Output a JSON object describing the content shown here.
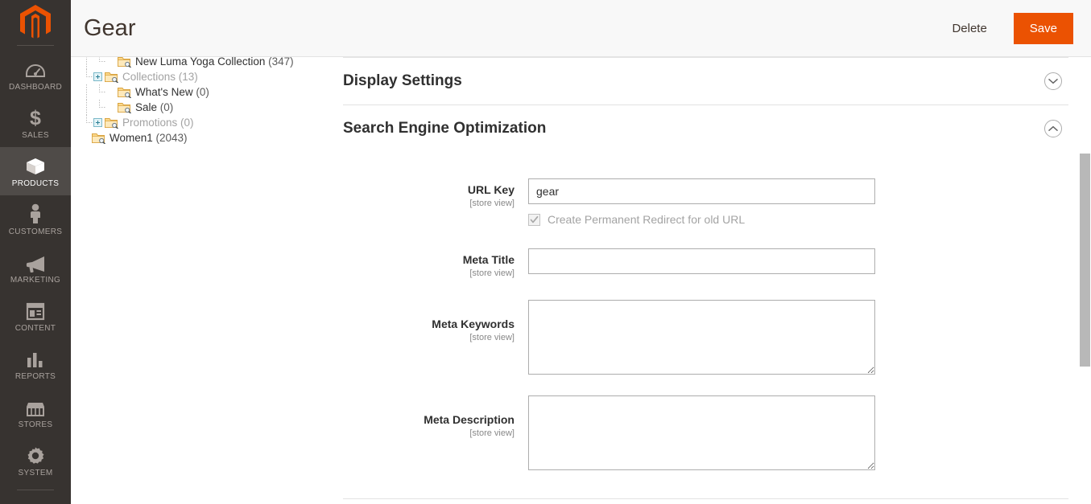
{
  "app": {
    "logo": "magento-logo",
    "brand_color": "#eb5202"
  },
  "sidebar": {
    "items": [
      {
        "label": "DASHBOARD",
        "icon": "dashboard-gauge-icon",
        "active": false
      },
      {
        "label": "SALES",
        "icon": "dollar-sign-icon",
        "active": false
      },
      {
        "label": "PRODUCTS",
        "icon": "box-icon",
        "active": true
      },
      {
        "label": "CUSTOMERS",
        "icon": "person-icon",
        "active": false
      },
      {
        "label": "MARKETING",
        "icon": "megaphone-icon",
        "active": false
      },
      {
        "label": "CONTENT",
        "icon": "layout-page-icon",
        "active": false
      },
      {
        "label": "REPORTS",
        "icon": "bar-chart-icon",
        "active": false
      },
      {
        "label": "STORES",
        "icon": "storefront-icon",
        "active": false
      },
      {
        "label": "SYSTEM",
        "icon": "gear-icon",
        "active": false
      }
    ]
  },
  "header": {
    "title": "Gear",
    "delete_label": "Delete",
    "save_label": "Save"
  },
  "category_tree": {
    "nodes": [
      {
        "label": "New Luma Yoga Collection",
        "count": "(347)",
        "indent": 2,
        "expandable": false,
        "muted": false,
        "last": false
      },
      {
        "label": "Collections",
        "count": "(13)",
        "indent": 1,
        "expandable": true,
        "muted": true,
        "last": false
      },
      {
        "label": "What's New",
        "count": "(0)",
        "indent": 2,
        "expandable": false,
        "muted": false,
        "last": false
      },
      {
        "label": "Sale",
        "count": "(0)",
        "indent": 2,
        "expandable": false,
        "muted": false,
        "last": true
      },
      {
        "label": "Promotions",
        "count": "(0)",
        "indent": 1,
        "expandable": true,
        "muted": true,
        "last": false
      },
      {
        "label": "Women1",
        "count": "(2043)",
        "indent": 0,
        "expandable": false,
        "muted": false,
        "last": true
      }
    ]
  },
  "main": {
    "sections": [
      {
        "title": "Display Settings",
        "expanded": false,
        "toggle_icon": "chevron-down-icon"
      },
      {
        "title": "Search Engine Optimization",
        "expanded": true,
        "toggle_icon": "chevron-up-icon"
      }
    ],
    "seo": {
      "url_key": {
        "label": "URL Key",
        "scope": "[store view]",
        "value": "gear",
        "placeholder": ""
      },
      "redirect_checkbox": {
        "label": "Create Permanent Redirect for old URL",
        "checked": true,
        "disabled": true
      },
      "meta_title": {
        "label": "Meta Title",
        "scope": "[store view]",
        "value": "",
        "placeholder": ""
      },
      "meta_keywords": {
        "label": "Meta Keywords",
        "scope": "[store view]",
        "value": "",
        "placeholder": ""
      },
      "meta_description": {
        "label": "Meta Description",
        "scope": "[store view]",
        "value": "",
        "placeholder": ""
      }
    }
  },
  "scrollbar": {
    "orientation": "vertical"
  }
}
